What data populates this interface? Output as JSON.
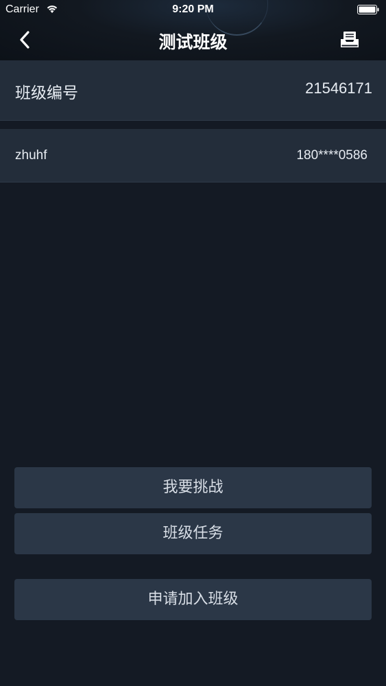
{
  "status_bar": {
    "carrier": "Carrier",
    "time": "9:20 PM"
  },
  "nav": {
    "title": "测试班级",
    "back_icon": "chevron-left-icon",
    "inbox_icon": "inbox-tray-icon"
  },
  "class_info": {
    "label": "班级编号",
    "value": "21546171"
  },
  "member": {
    "name": "zhuhf",
    "phone": "180****0586"
  },
  "buttons": {
    "challenge": "我要挑战",
    "tasks": "班级任务",
    "join": "申请加入班级"
  },
  "colors": {
    "background": "#141a24",
    "row_background": "#232d3a",
    "button_background": "#2b3747"
  }
}
